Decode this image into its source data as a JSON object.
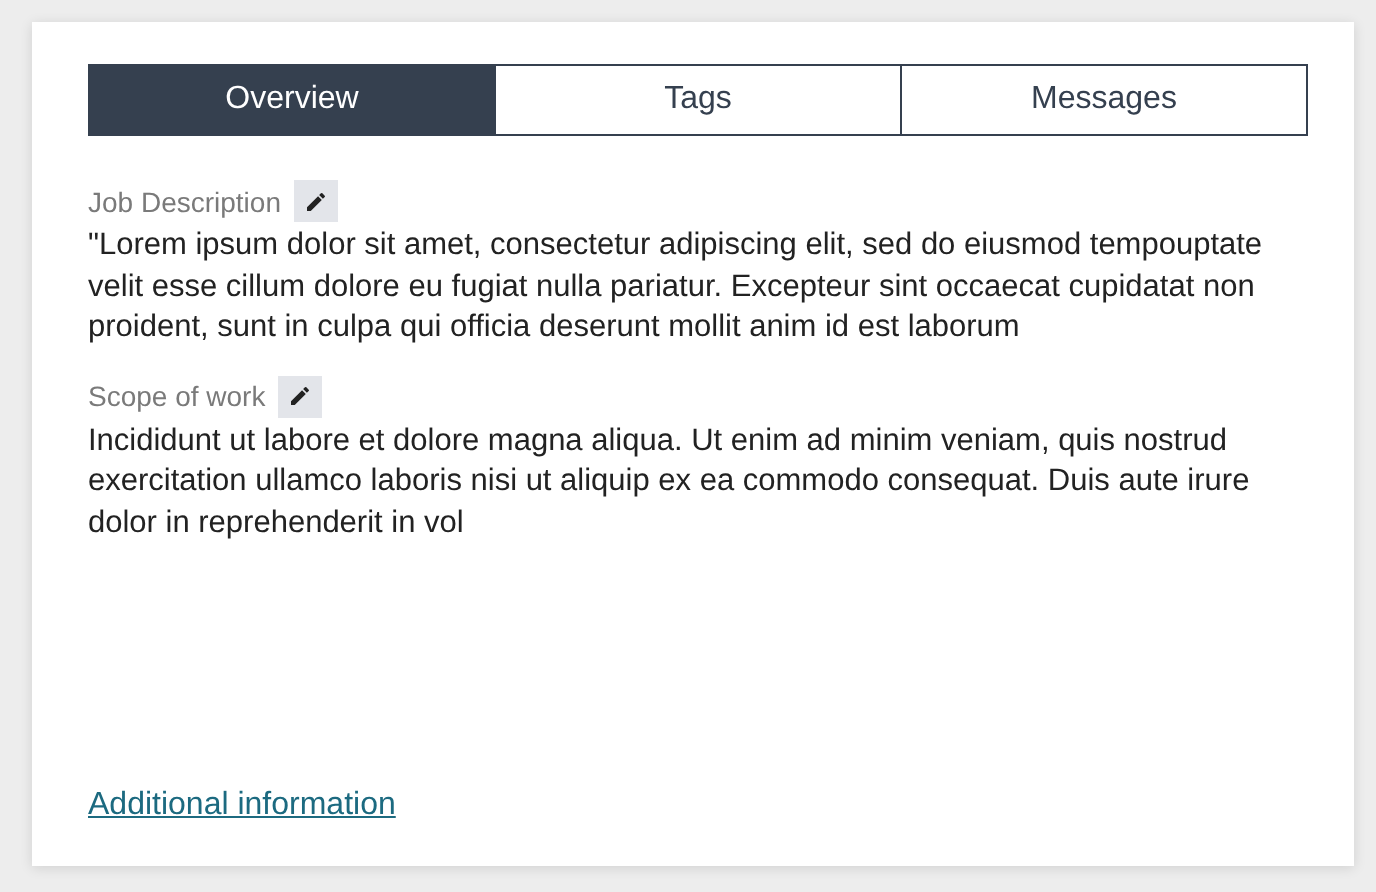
{
  "tabs": [
    {
      "label": "Overview",
      "selected": true
    },
    {
      "label": "Tags",
      "selected": false
    },
    {
      "label": "Messages",
      "selected": false
    }
  ],
  "sections": [
    {
      "label": "Job Description",
      "text": "\"Lorem ipsum dolor sit amet, consectetur adipiscing elit, sed do eiusmod tempouptate velit esse cillum dolore eu fugiat nulla pariatur. Excepteur sint occaecat cupidatat non proident, sunt in culpa qui officia deserunt mollit anim id est laborum"
    },
    {
      "label": "Scope of work",
      "text": "Incididunt ut labore et dolore magna aliqua. Ut enim ad minim veniam, quis nostrud exercitation ullamco laboris nisi ut aliquip ex ea commodo consequat. Duis aute irure dolor in reprehenderit in vol"
    }
  ],
  "link": "Additional information"
}
